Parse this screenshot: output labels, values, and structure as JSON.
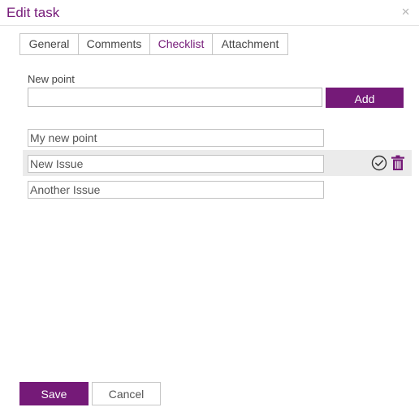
{
  "dialog": {
    "title": "Edit task",
    "close_icon": "close-icon"
  },
  "tabs": [
    {
      "label": "General",
      "active": false
    },
    {
      "label": "Comments",
      "active": false
    },
    {
      "label": "Checklist",
      "active": true
    },
    {
      "label": "Attachment",
      "active": false
    }
  ],
  "new_point": {
    "label": "New point",
    "value": "",
    "add_label": "Add"
  },
  "checklist": {
    "items": [
      {
        "text": "My new point"
      },
      {
        "text": "New Issue"
      },
      {
        "text": "Another Issue"
      }
    ],
    "hovered_item": "New Issue",
    "item_icons": [
      "check-circle-icon",
      "trash-icon"
    ]
  },
  "footer": {
    "save_label": "Save",
    "cancel_label": "Cancel"
  },
  "colors": {
    "accent": "#751a78",
    "row_highlight": "#ebebeb",
    "border": "#c6c6c6"
  }
}
